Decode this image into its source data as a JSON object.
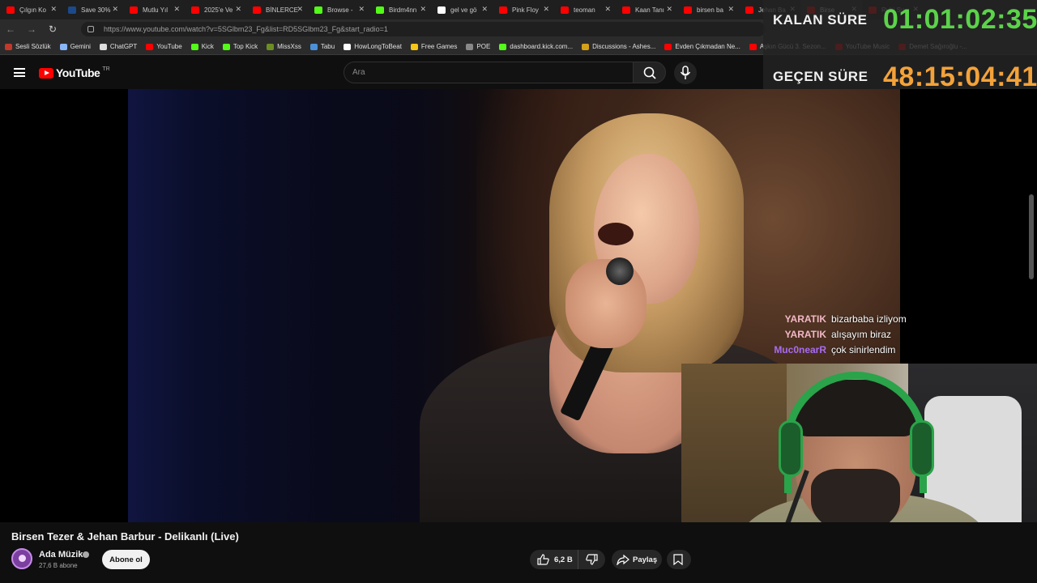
{
  "browser": {
    "tabs": [
      {
        "label": "Çılgın Ko",
        "color": "#ff0000"
      },
      {
        "label": "Save 30%",
        "color": "#1b4a8a"
      },
      {
        "label": "Mutlu Yıl",
        "color": "#ff0000"
      },
      {
        "label": "2025'e Ve",
        "color": "#ff0000"
      },
      {
        "label": "BİNLERCE",
        "color": "#ff0000"
      },
      {
        "label": "Browse -",
        "color": "#53fc18"
      },
      {
        "label": "Birdm4nn",
        "color": "#53fc18"
      },
      {
        "label": "gel ve gö",
        "color": "#ffffff"
      },
      {
        "label": "Pink Floy",
        "color": "#ff0000"
      },
      {
        "label": "teoman",
        "color": "#ff0000"
      },
      {
        "label": "Kaan Tanı",
        "color": "#ff0000"
      },
      {
        "label": "birsen ba",
        "color": "#ff0000"
      },
      {
        "label": "Jehan Ba",
        "color": "#ff0000"
      },
      {
        "label": "Birse",
        "color": "#ff0000"
      },
      {
        "label": "Rubi Su",
        "color": "#ff0000"
      }
    ],
    "url": "https://www.youtube.com/watch?v=5SGlbm23_Fg&list=RD5SGlbm23_Fg&start_radio=1",
    "bookmarks": [
      {
        "label": "Sesli Sözlük",
        "color": "#c0392b"
      },
      {
        "label": "Gemini",
        "color": "#8ab4f8"
      },
      {
        "label": "ChatGPT",
        "color": "#dddddd"
      },
      {
        "label": "YouTube",
        "color": "#ff0000"
      },
      {
        "label": "Kick",
        "color": "#53fc18"
      },
      {
        "label": "Top Kick",
        "color": "#53fc18"
      },
      {
        "label": "MissXss",
        "color": "#6b8e23"
      },
      {
        "label": "Tabu",
        "color": "#4a90d9"
      },
      {
        "label": "HowLongToBeat",
        "color": "#ffffff"
      },
      {
        "label": "Free Games",
        "color": "#f5c518"
      },
      {
        "label": "POE",
        "color": "#888888"
      },
      {
        "label": "dashboard.kick.com...",
        "color": "#53fc18"
      },
      {
        "label": "Discussions - Ashes...",
        "color": "#d4a017"
      },
      {
        "label": "Evden Çıkmadan Ne...",
        "color": "#ff0000"
      },
      {
        "label": "Aşkın Gücü 3. Sezon...",
        "color": "#ff0000"
      },
      {
        "label": "YouTube Music",
        "color": "#ff0000"
      },
      {
        "label": "Demet Sağıroğlu -...",
        "color": "#ff0000"
      }
    ]
  },
  "youtube": {
    "logo_text": "YouTube",
    "country": "TR",
    "search_placeholder": "Ara"
  },
  "timer": {
    "remaining_label": "KALAN SÜRE",
    "remaining_value": "01:01:02:35",
    "remaining_color": "#5bd34a",
    "elapsed_label": "GEÇEN SÜRE",
    "elapsed_value": "48:15:04:41",
    "elapsed_color": "#f3a23a"
  },
  "chat": [
    {
      "user": "YARATIK",
      "message": "bizarbaba izliyom",
      "color": "#f2b8c6"
    },
    {
      "user": "YARATIK",
      "message": "alışayım biraz",
      "color": "#f2b8c6"
    },
    {
      "user": "Muc0nearR",
      "message": "çok sinirlendim",
      "color": "#a86cf2"
    }
  ],
  "video": {
    "title": "Birsen Tezer & Jehan Barbur - Delikanlı (Live)",
    "channel": "Ada Müzik",
    "subscribers": "27,6 B abone",
    "subscribe_label": "Abone ol",
    "likes": "6,2 B",
    "share_label": "Paylaş"
  }
}
